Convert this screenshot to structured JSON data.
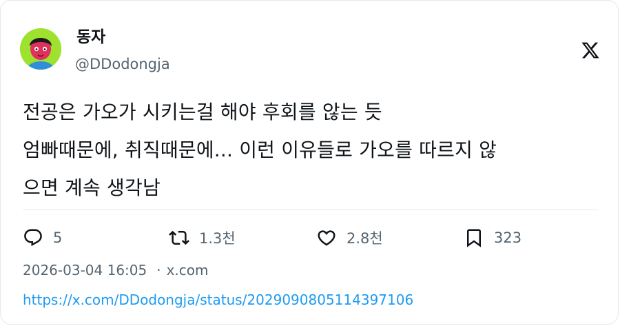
{
  "author": {
    "display_name": "동자",
    "handle": "@DDodongja",
    "avatar_icon": "avatar-icon"
  },
  "platform_icon": "x-logo-icon",
  "tweet": {
    "lines": [
      "전공은 가오가 시키는걸 해야 후회를 않는 듯",
      "엄빠때문에, 취직때문에... 이런 이유들로 가오를 따르지 않",
      "으면 계속 생각남"
    ]
  },
  "actions": {
    "reply": {
      "icon": "reply-icon",
      "count": "5"
    },
    "retweet": {
      "icon": "retweet-icon",
      "count": "1.3천"
    },
    "like": {
      "icon": "heart-icon",
      "count": "2.8천"
    },
    "bookmark": {
      "icon": "bookmark-icon",
      "count": "323"
    }
  },
  "meta": {
    "timestamp": "2026-03-04 16:05",
    "separator": "·",
    "source": "x.com"
  },
  "url": "https://x.com/DDodongja/status/2029090805114397106",
  "colors": {
    "text": "#0f1419",
    "secondary": "#536471",
    "link": "#1d9bf0",
    "avatar_bg": "#9fe12f"
  }
}
